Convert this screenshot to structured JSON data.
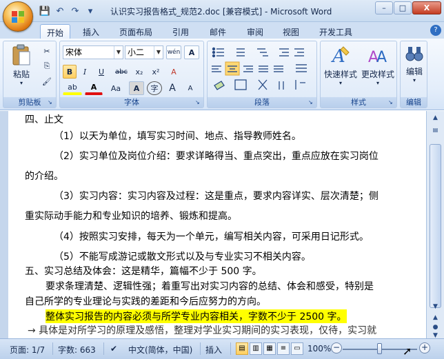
{
  "window": {
    "title": "认识实习报告格式_规范2.doc [兼容模式] - Microsoft Word",
    "controls": {
      "minimize": "–",
      "maximize": "□",
      "close": "X"
    }
  },
  "qat": {
    "save": "💾",
    "undo": "↶",
    "redo": "↷",
    "more": "▾"
  },
  "tabs": [
    "开始",
    "插入",
    "页面布局",
    "引用",
    "邮件",
    "审阅",
    "视图",
    "开发工具"
  ],
  "active_tab": "开始",
  "ribbon": {
    "clipboard": {
      "label": "剪贴板",
      "paste": "粘贴",
      "cut": "✂",
      "copy": "⎘",
      "format_painter": "🖌"
    },
    "font": {
      "label": "字体",
      "font_name": "宋体",
      "font_size": "小二",
      "wen": "wén",
      "char_border": "A",
      "bold": "B",
      "italic": "I",
      "underline": "U",
      "strike": "abc",
      "subscript": "x₂",
      "superscript": "x²",
      "clear": "A",
      "highlight": "ab",
      "font_color": "A",
      "change_case": "Aa",
      "char_shading": "A",
      "enclose": "字",
      "grow": "A",
      "shrink": "A"
    },
    "paragraph": {
      "label": "段落"
    },
    "styles": {
      "label": "样式",
      "quick_styles": "快速样式",
      "change_styles": "更改样式"
    },
    "editing": {
      "label": "编辑",
      "edit": "编辑"
    }
  },
  "document": {
    "lines": [
      "四、止文",
      "（1）以天为单位，填写实习时间、地点、指导教师姓名。",
      "（2）实习单位及岗位介绍：要求详略得当、重点突出，重点应放在实习岗位",
      "的介绍。",
      "（3）实习内容：实习内容及过程：这是重点，要求内容详实、层次清楚；侧",
      "重实际动手能力和专业知识的培养、锻炼和提高。",
      "（4）按照实习安排，每天为一个单元，编写相关内容，可采用日记形式。",
      "（5）不能写成游记或散文形式以及与专业实习不相关内容。",
      "五、实习总结及体会：这是精华，篇幅不少于 500 字。",
      "要求条理清楚、逻辑性强；着重写出对实习内容的总结、体会和感受，特别是",
      "自己所学的专业理论与实践的差距和今后应努力的方向。",
      "整体实习报告的内容必须与所学专业内容相关，字数不少于 2500 字。",
      "→ 具体是对所学习的原理及感悟，整理对学业实习期间的实习表现，仅待，实习就"
    ]
  },
  "status": {
    "page": "页面: 1/7",
    "words": "字数: 663",
    "language": "中文(简体，中国)",
    "mode": "插入",
    "zoom": "100%",
    "zoom_minus": "−",
    "zoom_plus": "+",
    "zoom_level_fraction": 0.5
  },
  "colors": {
    "accent": "#2b579a",
    "highlight": "#ffff00",
    "font_color": "#e01010"
  }
}
